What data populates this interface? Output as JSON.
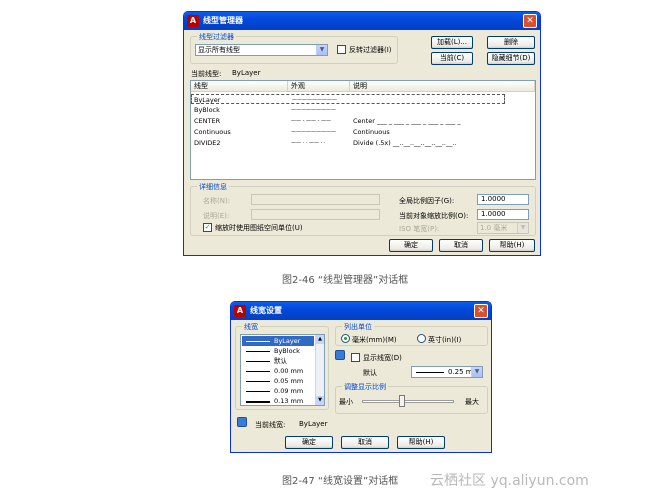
{
  "dialog1": {
    "title": "线型管理器",
    "filter_group_label": "线型过滤器",
    "filter_value": "显示所有线型",
    "invert_filter_label": "反转过滤器(I)",
    "load_button": "加载(L)...",
    "delete_button": "删除",
    "current_button": "当前(C)",
    "hide_details_button": "隐藏细节(D)",
    "current_linetype_label": "当前线型:",
    "current_linetype_value": "ByLayer",
    "columns": [
      "线型",
      "外观",
      "说明"
    ],
    "rows": [
      {
        "name": "ByLayer",
        "appearance": "—————————",
        "desc": ""
      },
      {
        "name": "ByBlock",
        "appearance": "—————————",
        "desc": ""
      },
      {
        "name": "CENTER",
        "appearance": "—— - —— - ——",
        "desc": "Center ___ _ ___ _ ___ _ ___ _ ___ _"
      },
      {
        "name": "Continuous",
        "appearance": "—————————",
        "desc": "Continuous"
      },
      {
        "name": "DIVIDE2",
        "appearance": "—— · · —— · ·",
        "desc": "Divide (.5x) __..__..__..__..__..__.."
      }
    ],
    "details_group_label": "详细信息",
    "name_label": "名称(N):",
    "desc_label": "说明(E):",
    "global_scale_label": "全局比例因子(G):",
    "global_scale_value": "1.0000",
    "current_scale_label": "当前对象缩放比例(O):",
    "current_scale_value": "1.0000",
    "iso_pen_label": "ISO 笔宽(P):",
    "iso_pen_value": "1.0 毫米",
    "paperspace_label": "缩放时使用图纸空间单位(U)",
    "ok_button": "确定",
    "cancel_button": "取消",
    "help_button": "帮助(H)"
  },
  "caption1": "图2-46 “线型管理器”对话框",
  "dialog2": {
    "title": "线宽设置",
    "lineweights_group": "线宽",
    "items": [
      "ByLayer",
      "ByBlock",
      "默认",
      "0.00 mm",
      "0.05 mm",
      "0.09 mm",
      "0.13 mm"
    ],
    "units_group": "列出单位",
    "mm_label": "毫米(mm)(M)",
    "inch_label": "英寸(in)(I)",
    "show_weight_label": "显示线宽(D)",
    "default_label": "默认",
    "default_value": "0.25 mm",
    "scale_group": "调整显示比例",
    "min_label": "最小",
    "max_label": "最大",
    "current_label": "当前线宽:",
    "current_value": "ByLayer",
    "ok_button": "确定",
    "cancel_button": "取消",
    "help_button": "帮助(H)"
  },
  "caption2": "图2-47 “线宽设置”对话框",
  "watermark": "云栖社区 yq.aliyun.com"
}
